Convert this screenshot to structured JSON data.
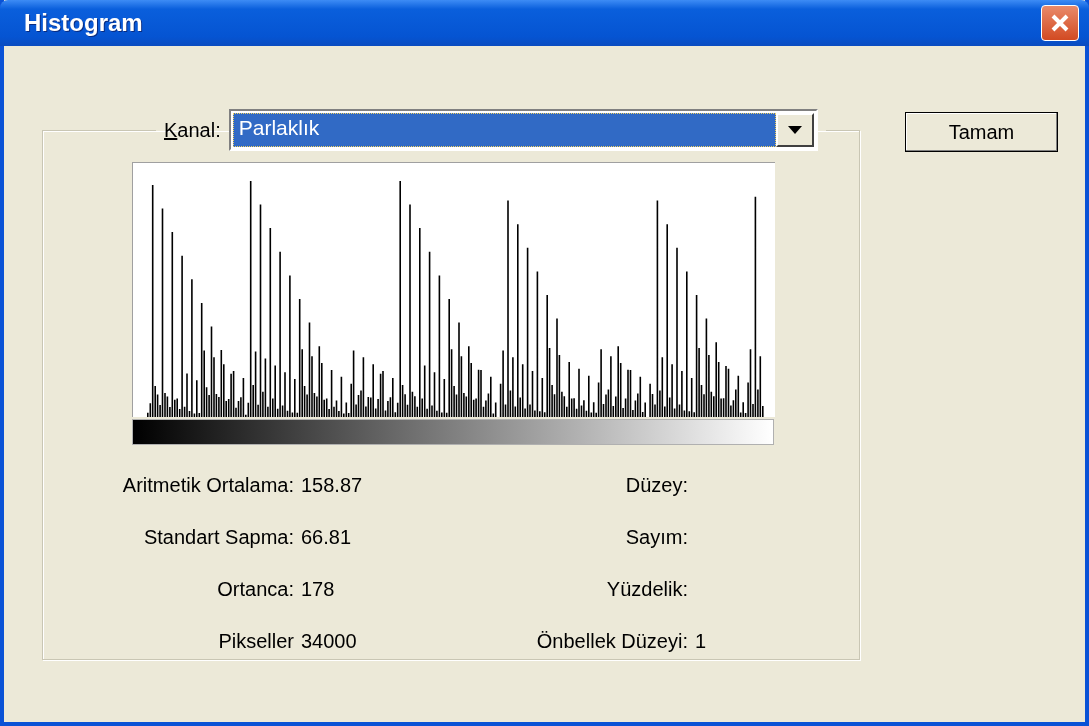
{
  "window": {
    "title": "Histogram"
  },
  "channel": {
    "label": "Kanal:",
    "value": "Parlaklık"
  },
  "buttons": [
    "Tamam"
  ],
  "stats_left": [
    {
      "label": "Aritmetik Ortalama:",
      "value": "158.87"
    },
    {
      "label": "Standart Sapma:",
      "value": "66.81"
    },
    {
      "label": "Ortanca:",
      "value": "178"
    },
    {
      "label": "Pikseller",
      "value": "34000"
    }
  ],
  "stats_right": [
    {
      "label": "Düzey:"
    },
    {
      "label": "Sayım:"
    },
    {
      "label": "Yüzdelik:"
    },
    {
      "label": "Önbellek Düzeyi:",
      "value": "1"
    }
  ]
}
